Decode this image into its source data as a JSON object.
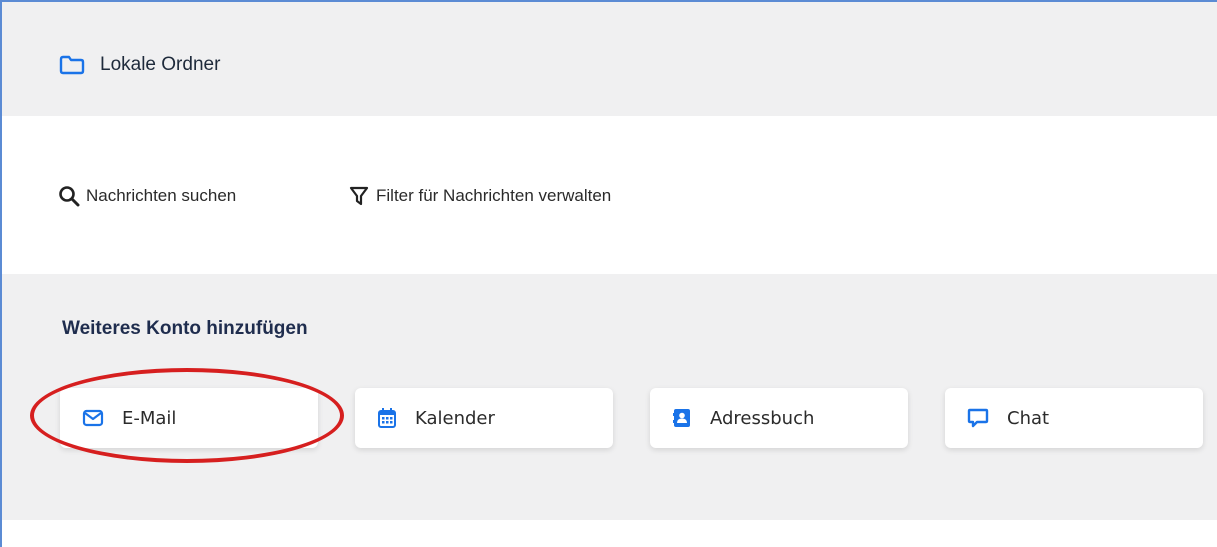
{
  "header": {
    "folder_label": "Lokale Ordner",
    "icon": "folder-icon"
  },
  "toolbar": {
    "search_label": "Nachrichten suchen",
    "filter_label": "Filter für Nachrichten verwalten"
  },
  "add_account": {
    "title": "Weiteres Konto hinzufügen",
    "options": [
      {
        "label": "E-Mail",
        "icon": "mail-icon"
      },
      {
        "label": "Kalender",
        "icon": "calendar-icon"
      },
      {
        "label": "Adressbuch",
        "icon": "address-book-icon"
      },
      {
        "label": "Chat",
        "icon": "chat-icon"
      }
    ],
    "highlighted_option": "E-Mail"
  },
  "colors": {
    "accent": "#1a73e8",
    "highlight": "#d61f1f",
    "section_bg": "#f0f0f1",
    "title_text": "#1f2d4e"
  }
}
